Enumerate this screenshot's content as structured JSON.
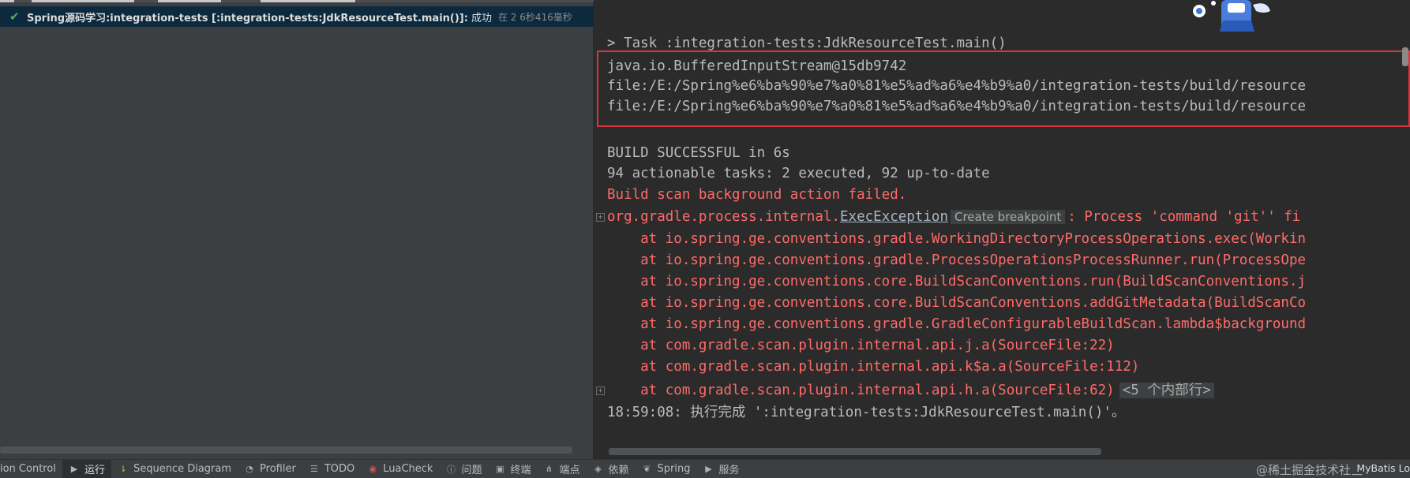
{
  "run_tree": {
    "title": "Spring源码学习:integration-tests [:integration-tests:JdkResourceTest.main()]:",
    "status": "成功",
    "time": "在 2 6秒416毫秒"
  },
  "console": {
    "task_line": "> Task :integration-tests:JdkResourceTest.main()",
    "output_lines": [
      "java.io.BufferedInputStream@15db9742",
      "file:/E:/Spring%e6%ba%90%e7%a0%81%e5%ad%a6%e4%b9%a0/integration-tests/build/resource",
      "file:/E:/Spring%e6%ba%90%e7%a0%81%e5%ad%a6%e4%b9%a0/integration-tests/build/resource"
    ],
    "build_successful": "BUILD SUCCESSFUL in 6s",
    "actionable": "94 actionable tasks: 2 executed, 92 up-to-date",
    "scan_failed": "Build scan background action failed.",
    "exception_prefix": "org.gradle.process.internal.",
    "exception_link": "ExecException",
    "create_breakpoint": "Create breakpoint",
    "exception_suffix": ": Process 'command 'git'' fi",
    "stack": [
      "    at io.spring.ge.conventions.gradle.WorkingDirectoryProcessOperations.exec(Workin",
      "    at io.spring.ge.conventions.gradle.ProcessOperationsProcessRunner.run(ProcessOpe",
      "    at io.spring.ge.conventions.core.BuildScanConventions.run(BuildScanConventions.j",
      "    at io.spring.ge.conventions.core.BuildScanConventions.addGitMetadata(BuildScanCo",
      "    at io.spring.ge.conventions.gradle.GradleConfigurableBuildScan.lambda$background",
      "    at com.gradle.scan.plugin.internal.api.j.a(SourceFile:22)",
      "    at com.gradle.scan.plugin.internal.api.k$a.a(SourceFile:112)",
      "    at com.gradle.scan.plugin.internal.api.h.a(SourceFile:62)"
    ],
    "folded_frames": "<5 个内部行>",
    "finished": "18:59:08: 执行完成 ':integration-tests:JdkResourceTest.main()'。"
  },
  "bottom_bar": {
    "tabs": [
      {
        "label": "Version Control",
        "icon": "version-control-icon"
      },
      {
        "label": "运行",
        "icon": "run-icon"
      },
      {
        "label": "Sequence Diagram",
        "icon": "sequence-diagram-icon"
      },
      {
        "label": "Profiler",
        "icon": "profiler-icon"
      },
      {
        "label": "TODO",
        "icon": "todo-icon"
      },
      {
        "label": "LuaCheck",
        "icon": "luacheck-icon"
      },
      {
        "label": "问题",
        "icon": "problems-icon"
      },
      {
        "label": "终端",
        "icon": "terminal-icon"
      },
      {
        "label": "端点",
        "icon": "endpoints-icon"
      },
      {
        "label": "依赖",
        "icon": "dependencies-icon"
      },
      {
        "label": "Spring",
        "icon": "spring-icon"
      },
      {
        "label": "服务",
        "icon": "services-icon"
      }
    ],
    "watermark": "@稀土掘金技术社区",
    "mybatis": "MyBatis Lo"
  },
  "colors": {
    "error_red": "#ff6b68",
    "success_green": "#59a869",
    "highlight_box": "#d9363e"
  }
}
